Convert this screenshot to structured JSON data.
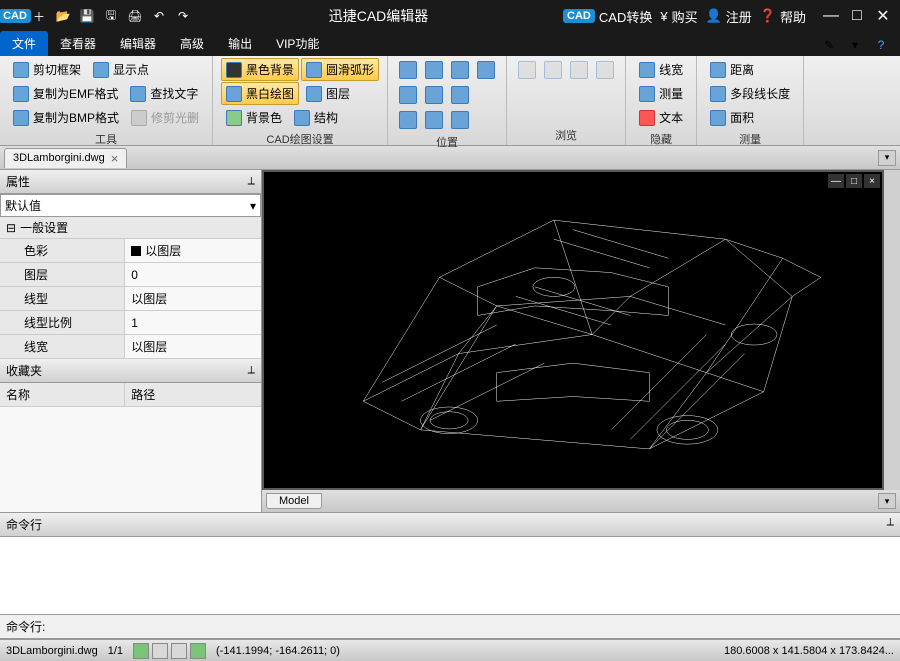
{
  "titlebar": {
    "app_title": "迅捷CAD编辑器",
    "links": {
      "cad_convert": "CAD转换",
      "buy": "购买",
      "register": "注册",
      "help": "帮助"
    }
  },
  "menubar": {
    "tabs": [
      "文件",
      "查看器",
      "编辑器",
      "高级",
      "输出",
      "VIP功能"
    ],
    "active_index": 0
  },
  "ribbon": {
    "groups": [
      {
        "label": "工具",
        "items": [
          "剪切框架",
          "显示点",
          "复制为EMF格式",
          "查找文字",
          "复制为BMP格式",
          "修剪光删"
        ]
      },
      {
        "label": "CAD绘图设置",
        "items": [
          "黑色背景",
          "圆滑弧形",
          "黑白绘图",
          "图层",
          "背景色",
          "结构"
        ]
      },
      {
        "label": "位置"
      },
      {
        "label": "浏览"
      },
      {
        "label": "隐藏",
        "items": [
          "线宽",
          "测量",
          "文本"
        ]
      },
      {
        "label": "测量",
        "items": [
          "距离",
          "多段线长度",
          "面积"
        ]
      }
    ]
  },
  "doc_tab": {
    "name": "3DLamborgini.dwg"
  },
  "props_panel": {
    "title": "属性",
    "combo": "默认值",
    "section": "一般设置",
    "rows": [
      {
        "k": "色彩",
        "v": "以图层",
        "swatch": true
      },
      {
        "k": "图层",
        "v": "0"
      },
      {
        "k": "线型",
        "v": "以图层"
      },
      {
        "k": "线型比例",
        "v": "1"
      },
      {
        "k": "线宽",
        "v": "以图层"
      }
    ]
  },
  "fav_panel": {
    "title": "收藏夹",
    "cols": [
      "名称",
      "路径"
    ]
  },
  "model_tab": "Model",
  "cmd_panel": {
    "title": "命令行",
    "prompt": "命令行:"
  },
  "statusbar": {
    "file": "3DLamborgini.dwg",
    "ratio": "1/1",
    "coords": "(-141.1994; -164.2611; 0)",
    "dims": "180.6008 x 141.5804 x 173.8424..."
  }
}
